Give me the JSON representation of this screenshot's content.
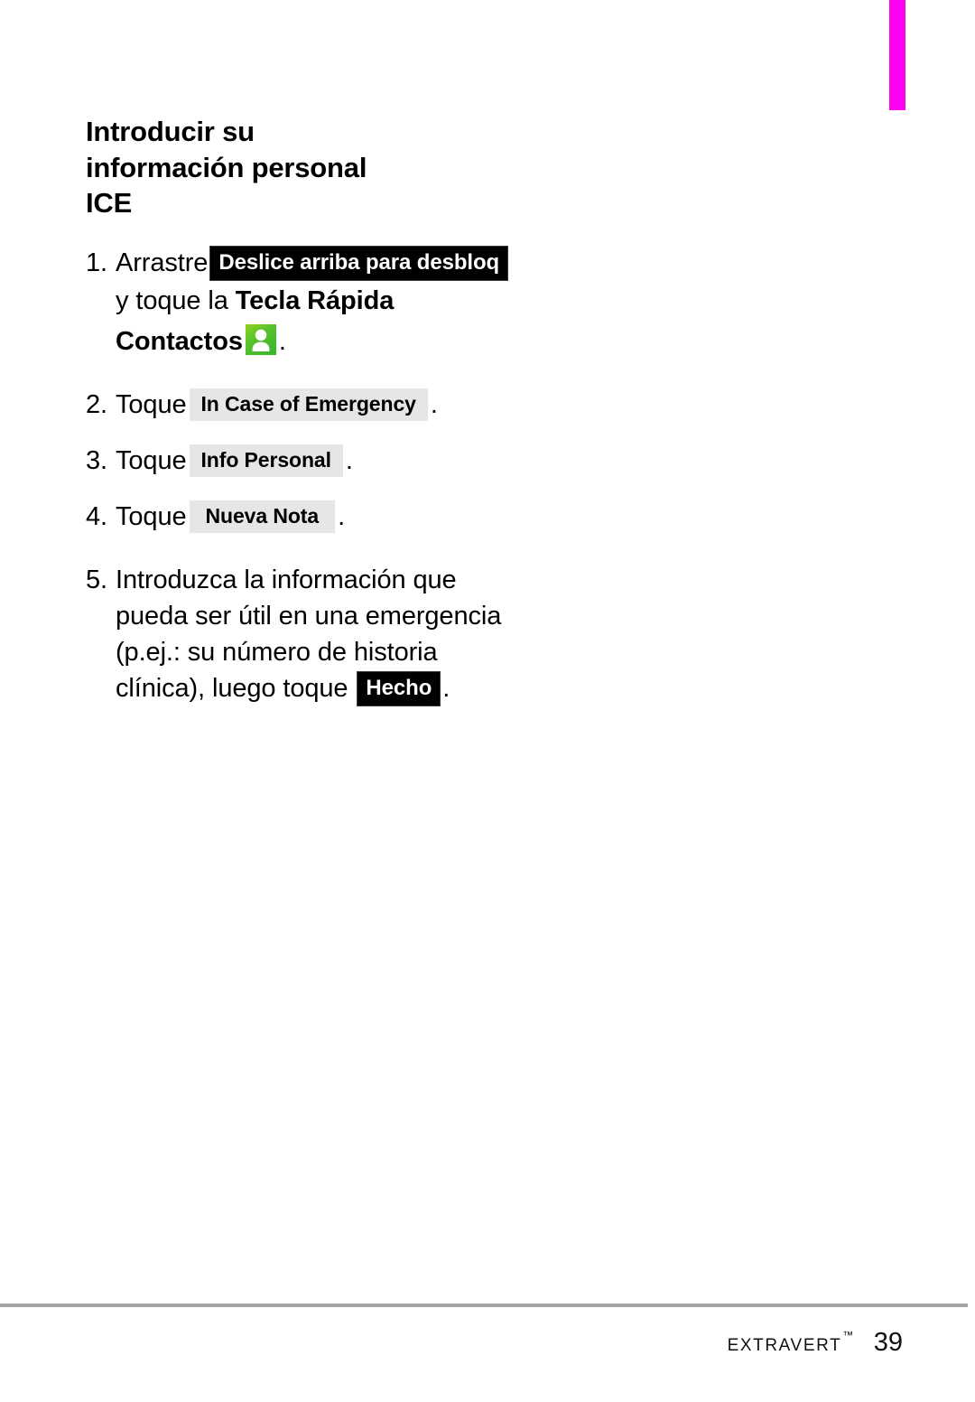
{
  "page": {
    "heading": "Introducir su información personal ICE",
    "heading_line_1": "Introducir su información",
    "heading_line_2": "personal ICE"
  },
  "chapter_tab": {
    "color": "#ff00f0"
  },
  "steps": [
    {
      "number": "1.",
      "lead": "Arrastre",
      "key": "Deslice arriba para desbloq",
      "key_style": "dark",
      "line_2_prefix": "y toque la ",
      "line_2_bold": "Tecla Rápida",
      "line_3_bold": "Contactos",
      "icon": "contacts-icon",
      "trailing": "."
    },
    {
      "number": "2.",
      "lead": "Toque",
      "key": "In Case of Emergency",
      "key_style": "light",
      "trailing": "."
    },
    {
      "number": "3.",
      "lead": "Toque",
      "key": "Info Personal",
      "key_style": "light",
      "trailing": "."
    },
    {
      "number": "4.",
      "lead": "Toque",
      "key": "Nueva Nota",
      "key_style": "light-wide",
      "trailing": "."
    },
    {
      "number": "5.",
      "line_1": "Introduzca la información que",
      "line_2": "pueda ser útil en una emergencia",
      "line_3": "(p.ej.: su número de historia",
      "line_4_prefix": "clínica), luego toque ",
      "key": "Hecho",
      "key_style": "dark",
      "trailing": "."
    }
  ],
  "footer": {
    "brand": "Extravert",
    "trademark": "™",
    "page_number": "39"
  },
  "colors": {
    "key_dark_bg": "#000000",
    "key_light_bg": "#e6e6e6",
    "contact_icon_green": "#56c22b",
    "rule": "#a3a3a3",
    "tab_magenta": "#ff00f0"
  }
}
